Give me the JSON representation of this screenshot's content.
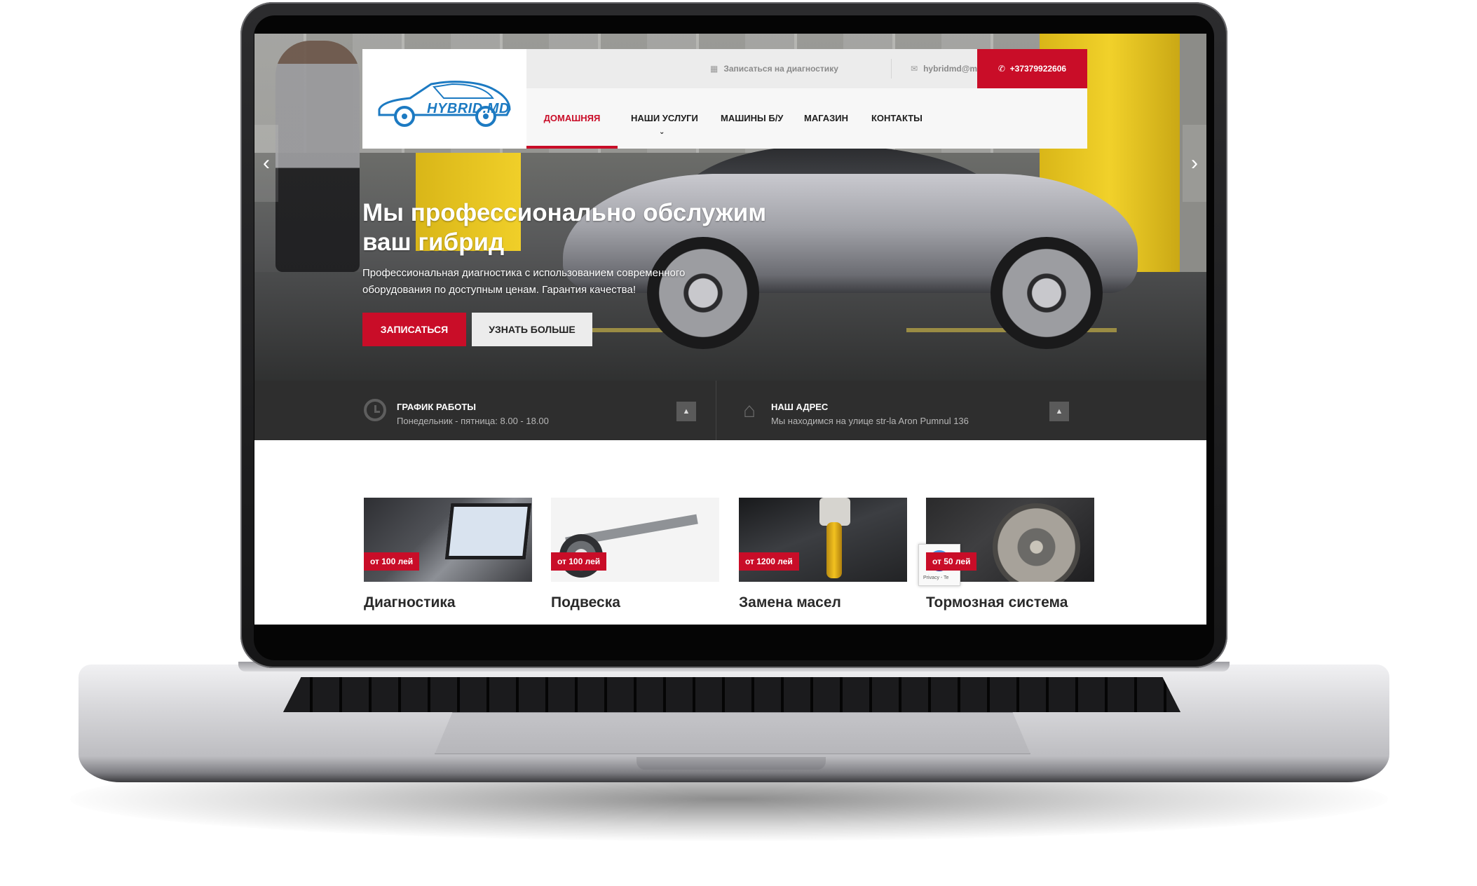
{
  "header": {
    "logo_text": "HYBRID.MD",
    "signup_link": "Записаться на диагностику",
    "email": "hybridmd@mail.ru",
    "phone": "+37379922606"
  },
  "nav": {
    "items": [
      {
        "label": "ДОМАШНЯЯ",
        "active": true
      },
      {
        "label": "НАШИ УСЛУГИ",
        "has_dropdown": true
      },
      {
        "label": "МАШИНЫ Б/У"
      },
      {
        "label": "МАГАЗИН"
      },
      {
        "label": "КОНТАКТЫ"
      }
    ]
  },
  "hero": {
    "title": "Мы профессионально обслужим ваш гибрид",
    "subtitle": "Профессиональная диагностика с использованием современного оборудования по доступным ценам. Гарантия качества!",
    "primary_button": "ЗАПИСАТЬСЯ",
    "secondary_button": "УЗНАТЬ БОЛЬШЕ"
  },
  "info": {
    "schedule_title": "ГРАФИК РАБОТЫ",
    "schedule_text": "Понедельник - пятница: 8.00 - 18.00",
    "address_title": "НАШ АДРЕС",
    "address_text": "Мы находимся на улице str-la Aron Pumnul 136"
  },
  "services": [
    {
      "title": "Диагностика",
      "price": "от 100 лей"
    },
    {
      "title": "Подвеска",
      "price": "от 100 лей"
    },
    {
      "title": "Замена масел",
      "price": "от 1200 лей"
    },
    {
      "title": "Тормозная система",
      "price": "от 50 лей"
    }
  ],
  "recaptcha": {
    "label": "Privacy - Te"
  },
  "colors": {
    "accent": "#c90d28",
    "logo": "#1c7ac2",
    "infobar": "#2e2e2e"
  },
  "icons": {
    "calendar": "calendar-icon",
    "mail": "mail-icon",
    "phone": "phone-icon",
    "clock": "clock-icon",
    "home": "home-icon",
    "chevron_up": "chevron-up-icon",
    "chevron_down": "chevron-down-icon",
    "arrow_left": "arrow-left-icon",
    "arrow_right": "arrow-right-icon"
  }
}
